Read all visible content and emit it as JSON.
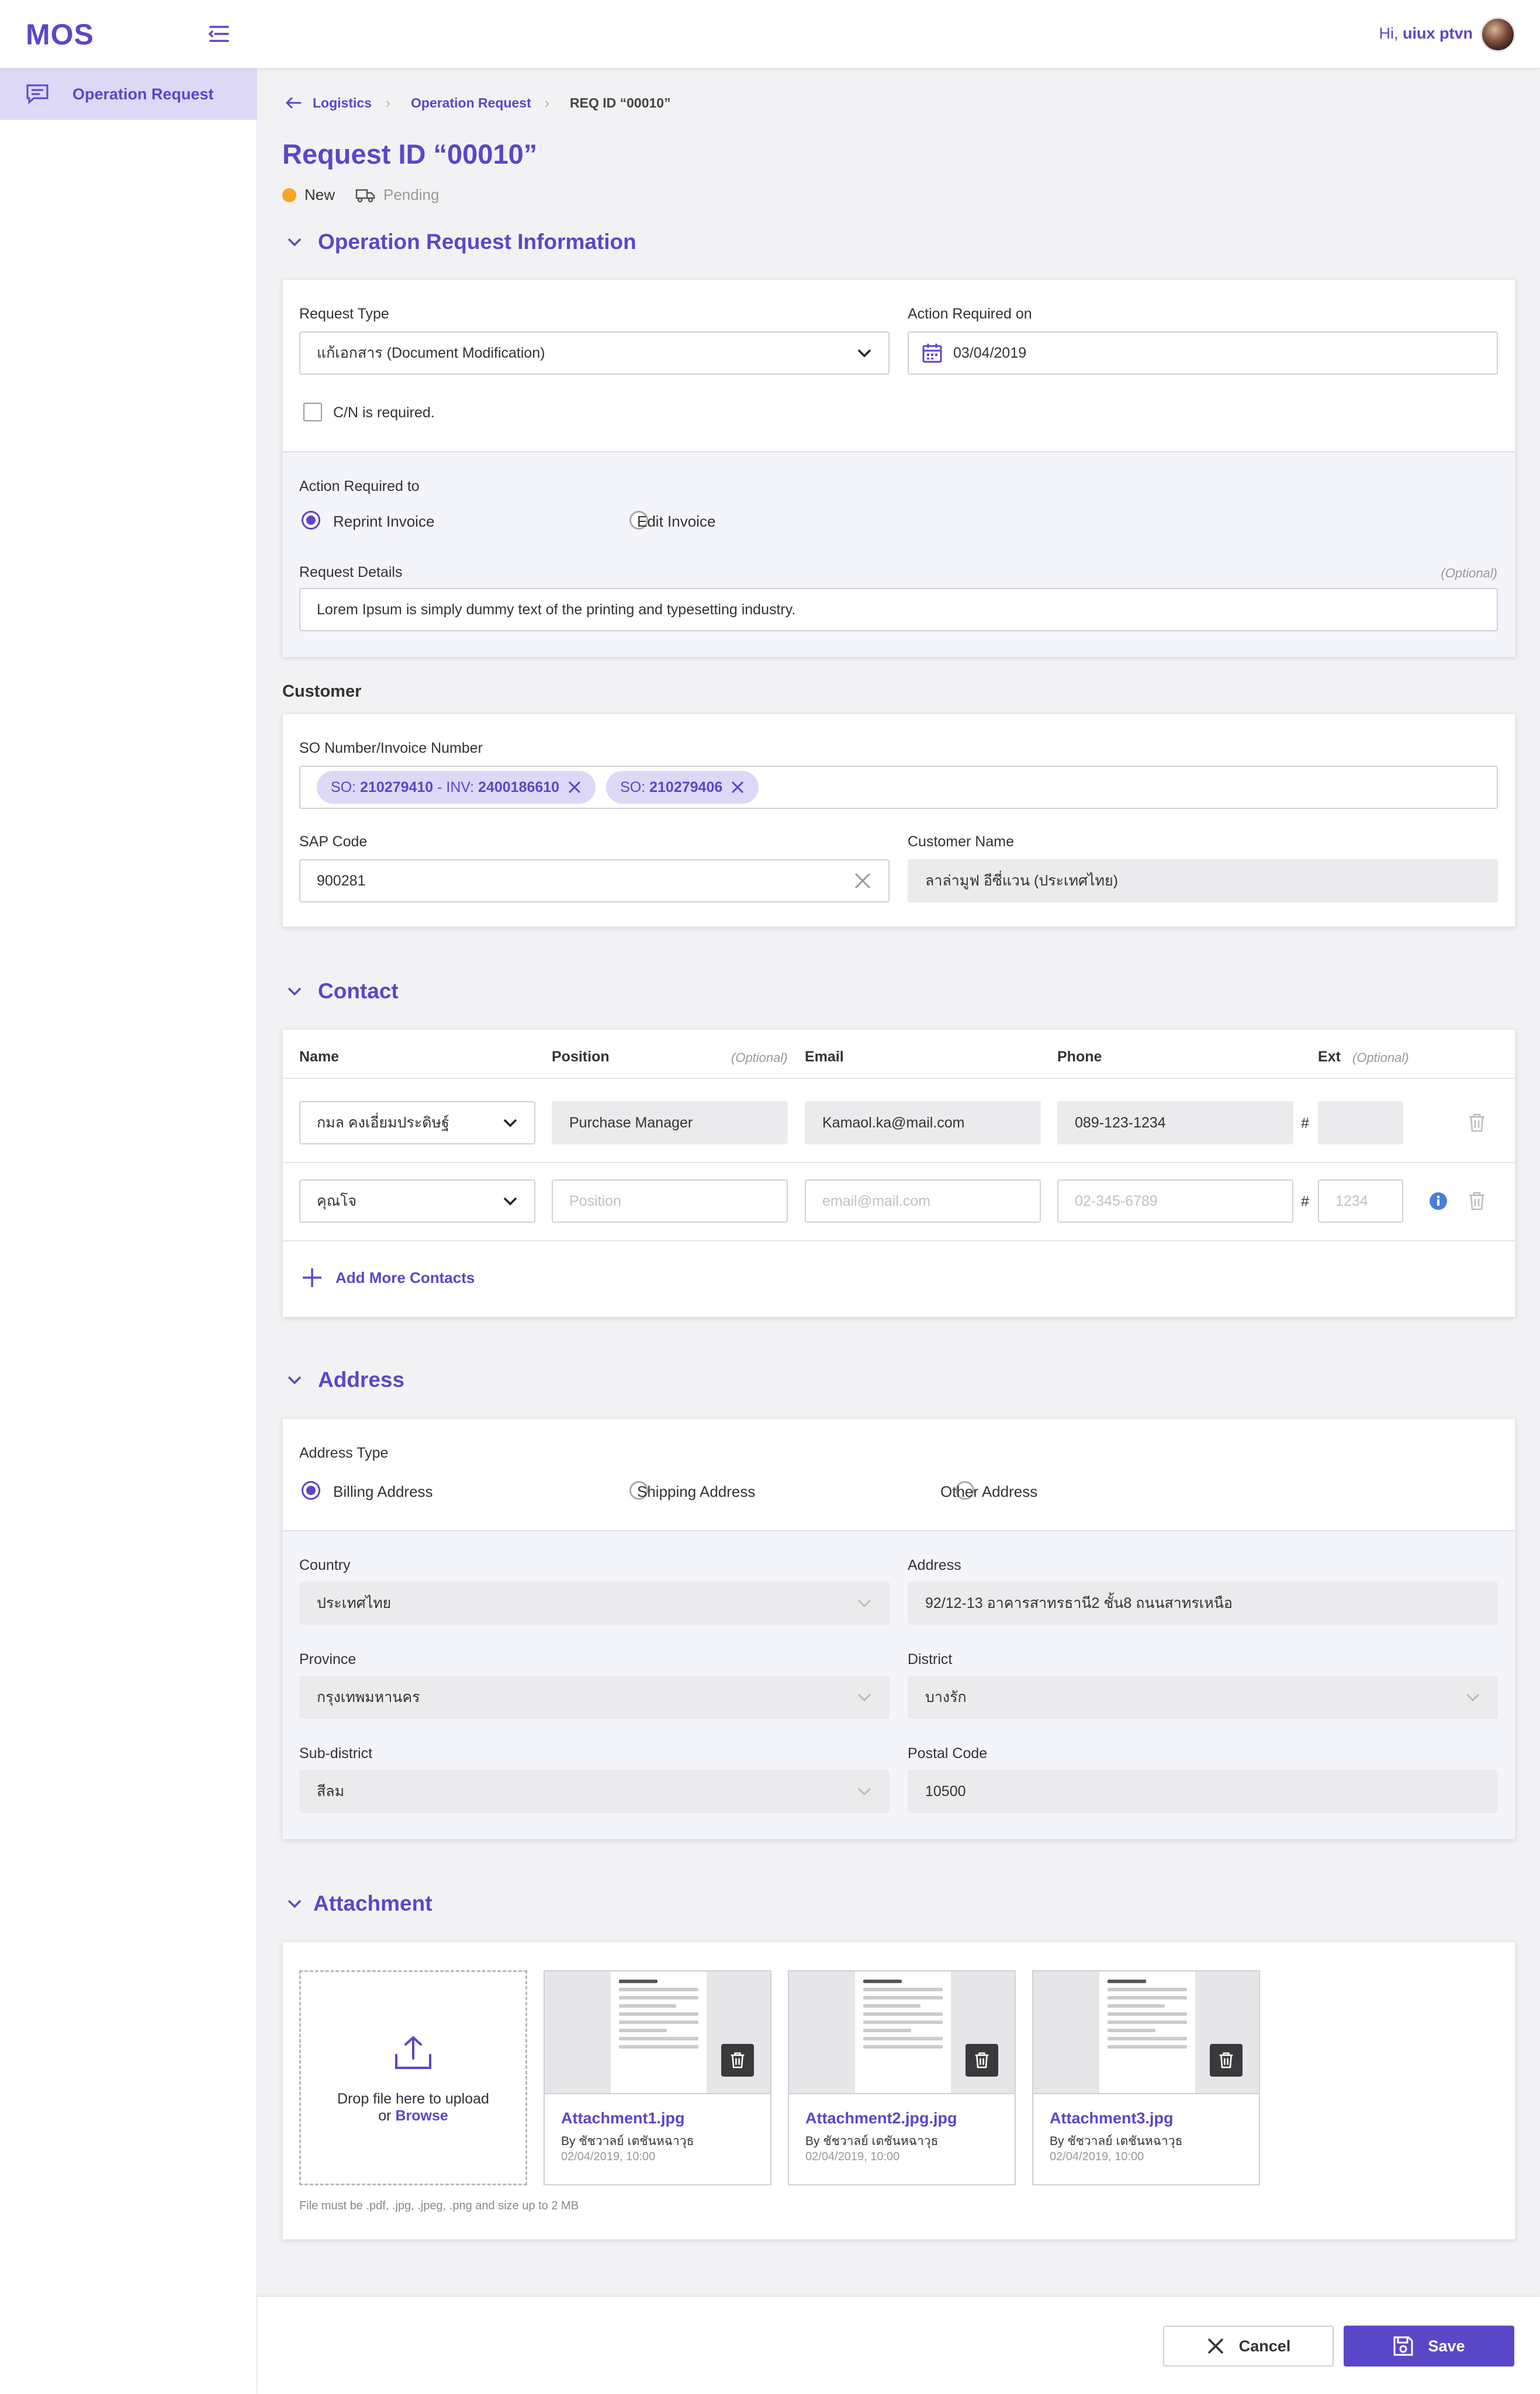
{
  "app": {
    "logo": "MOS"
  },
  "header": {
    "greeting_prefix": "Hi,",
    "user_name": "uiux ptvn"
  },
  "sidebar": {
    "items": [
      {
        "label": "Operation Request",
        "icon": "message-icon"
      }
    ]
  },
  "breadcrumb": {
    "items": [
      "Logistics",
      "Operation Request",
      "REQ ID “00010”"
    ]
  },
  "page": {
    "title": "Request ID “00010”",
    "status_new": "New",
    "status_pending": "Pending",
    "status_new_color": "#f5a623"
  },
  "operation_info": {
    "heading": "Operation Request Information",
    "request_type_label": "Request Type",
    "request_type_value": "แก้เอกสาร (Document Modification)",
    "action_required_on_label": "Action Required on",
    "action_required_on_value": "03/04/2019",
    "cn_required_label": "C/N is required.",
    "action_required_to_label": "Action Required to",
    "radio_options": [
      "Reprint Invoice",
      "Edit Invoice"
    ],
    "selected_option": "Reprint Invoice",
    "request_details_label": "Request Details",
    "optional_label": "(Optional)",
    "request_details_value": "Lorem Ipsum is simply dummy text of the printing and typesetting industry."
  },
  "customer": {
    "heading": "Customer",
    "so_label": "SO Number/Invoice Number",
    "chips": [
      {
        "prefix": "SO:",
        "so": "210279410",
        "mid": "- INV:",
        "inv": "2400186610"
      },
      {
        "prefix": "SO:",
        "so": "210279406"
      }
    ],
    "sap_code_label": "SAP Code",
    "sap_code_value": "900281",
    "customer_name_label": "Customer Name",
    "customer_name_value": "ลาล่ามูฟ อีซี่แวน (ประเทศไทย)"
  },
  "contact": {
    "heading": "Contact",
    "columns": {
      "name": "Name",
      "position": "Position",
      "position_opt": "(Optional)",
      "email": "Email",
      "phone": "Phone",
      "ext": "Ext",
      "ext_opt": "(Optional)"
    },
    "rows": [
      {
        "name": "กมล คงเอี่ยมประดิษฐ์",
        "position": "Purchase Manager",
        "email": "Kamaol.ka@mail.com",
        "phone": "089-123-1234",
        "ext": ""
      },
      {
        "name": "คุณโจ",
        "position_placeholder": "Position",
        "email_placeholder": "email@mail.com",
        "phone_placeholder": "02-345-6789",
        "ext_placeholder": "1234"
      }
    ],
    "hash": "#",
    "add_more_label": "Add More Contacts"
  },
  "address": {
    "heading": "Address",
    "type_label": "Address Type",
    "types": [
      "Billing Address",
      "Shipping Address",
      "Other Address"
    ],
    "selected_type": "Billing Address",
    "country_label": "Country",
    "country_value": "ประเทศไทย",
    "address_label": "Address",
    "address_value": "92/12-13 อาคารสาทรธานี2 ชั้น8 ถนนสาทรเหนือ",
    "province_label": "Province",
    "province_value": "กรุงเทพมหานคร",
    "district_label": "District",
    "district_value": "บางรัก",
    "subdistrict_label": "Sub-district",
    "subdistrict_value": "สีลม",
    "postal_label": "Postal Code",
    "postal_value": "10500"
  },
  "attachment": {
    "heading": "Attachment",
    "drop_text": "Drop file here to upload",
    "or_text": "or",
    "browse_text": "Browse",
    "files": [
      {
        "name": "Attachment1.jpg",
        "by": "By ชัชวาลย์ เตชันหฉาวุธ",
        "date": "02/04/2019, 10:00"
      },
      {
        "name": "Attachment2.jpg.jpg",
        "by": "By ชัชวาลย์ เตชันหฉาวุธ",
        "date": "02/04/2019, 10:00"
      },
      {
        "name": "Attachment3.jpg",
        "by": "By ชัชวาลย์ เตชันหฉาวุธ",
        "date": "02/04/2019, 10:00"
      }
    ],
    "note": "File must be .pdf, .jpg, .jpeg, .png and size up to 2 MB"
  },
  "footer": {
    "cancel_label": "Cancel",
    "save_label": "Save",
    "primary_color": "#5a47c8"
  }
}
